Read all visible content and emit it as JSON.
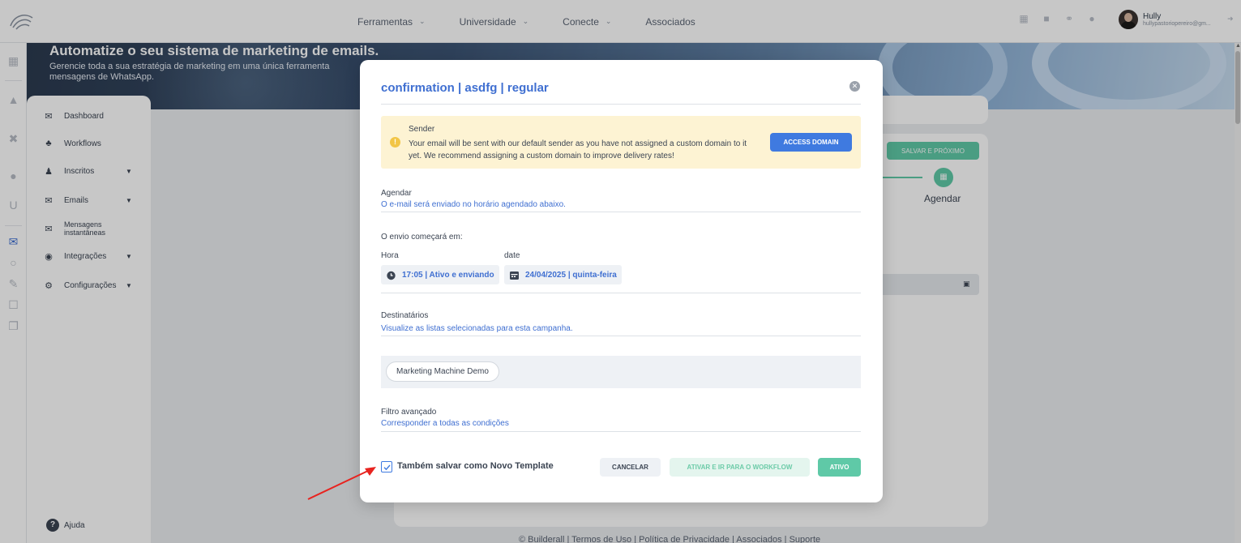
{
  "topbar": {
    "nav": [
      {
        "label": "Ferramentas"
      },
      {
        "label": "Universidade"
      },
      {
        "label": "Conecte"
      },
      {
        "label": "Associados"
      }
    ],
    "user": {
      "name": "Hully",
      "email": "hullypastoriopereiro@gm..."
    }
  },
  "hero": {
    "title": "Automatize o seu sistema de marketing de emails.",
    "subtitle": "Gerencie toda a sua estratégia de marketing em uma única ferramenta mensagens de WhatsApp."
  },
  "sidebar": {
    "items": [
      {
        "label": "Dashboard",
        "icon": "mail-icon"
      },
      {
        "label": "Workflows",
        "icon": "workflow-icon"
      },
      {
        "label": "Inscritos",
        "icon": "users-icon"
      },
      {
        "label": "Emails",
        "icon": "emails-icon"
      },
      {
        "label": "Mensagens instantâneas",
        "icon": "chat-icon"
      },
      {
        "label": "Integrações",
        "icon": "integrations-icon"
      },
      {
        "label": "Configurações",
        "icon": "gear-icon"
      }
    ],
    "help": "Ajuda"
  },
  "background": {
    "save_next": "SALVAR E PRÓXIMO",
    "step_label": "Agendar",
    "footer": "© Builderall  |  Termos de Uso  |  Política de Privacidade  |  Associados  |  Suporte"
  },
  "modal": {
    "title": "confirmation | asdfg | regular",
    "alert": {
      "title": "Sender",
      "text": "Your email will be sent with our default sender as you have not assigned a custom domain to it yet. We recommend assigning a custom domain to improve delivery rates!",
      "button": "ACCESS DOMAIN"
    },
    "schedule": {
      "label": "Agendar",
      "description": "O e-mail será enviado no horário agendado abaixo.",
      "start_label": "O envio começará em:",
      "hour_label": "Hora",
      "date_label": "date",
      "hour_value": "17:05 | Ativo e enviando",
      "date_value": "24/04/2025 | quinta-feira"
    },
    "recipients": {
      "label": "Destinatários",
      "description": "Visualize as listas selecionadas para esta campanha.",
      "lists": [
        "Marketing Machine Demo"
      ]
    },
    "filter": {
      "label": "Filtro avançado",
      "description": "Corresponder a todas as condições"
    },
    "save_template": {
      "label": "Também salvar como Novo Template",
      "checked": true
    },
    "buttons": {
      "cancel": "CANCELAR",
      "activate_workflow": "ATIVAR E IR PARA O WORKFLOW",
      "active": "ATIVO"
    }
  },
  "colors": {
    "accent_blue": "#3f6fd1",
    "button_blue": "#3f7ae0",
    "success_green": "#5fc9a7",
    "alert_bg": "#fdf3d3",
    "annotation_red": "#e8231f"
  }
}
